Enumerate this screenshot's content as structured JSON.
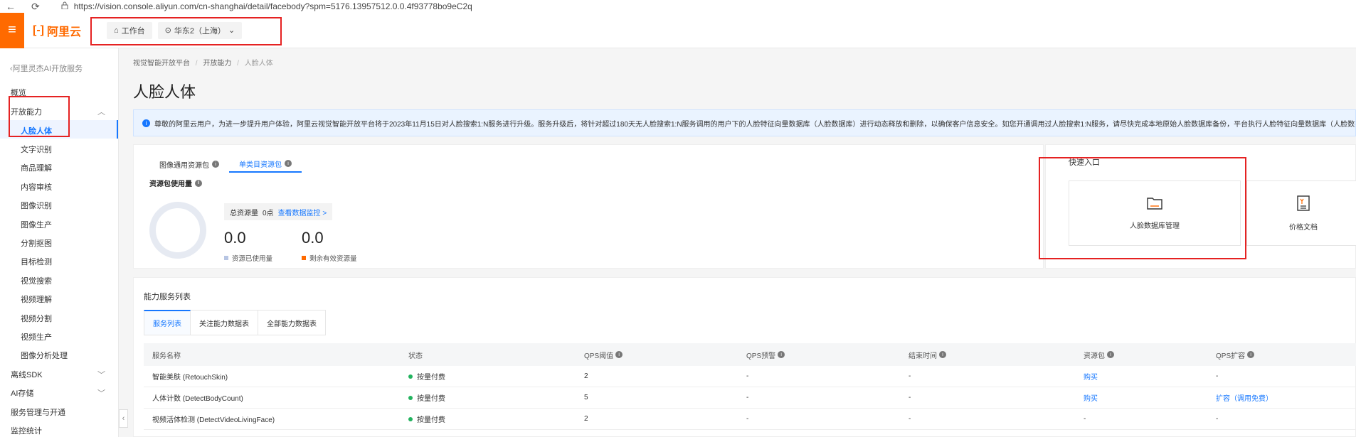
{
  "browser": {
    "back_icon": "←",
    "reload_icon": "⟳",
    "url": "https://vision.console.aliyun.com/cn-shanghai/detail/facebody?spm=5176.13957512.0.0.4f93778bo9eC2q"
  },
  "topbar": {
    "logo_text": "阿里云",
    "workbench": "工作台",
    "region": "华东2（上海）"
  },
  "sidebar": {
    "back_label": "阿里灵杰AI开放服务",
    "items": {
      "overview": "概览",
      "open_ability": "开放能力",
      "face_body": "人脸人体",
      "ocr": "文字识别",
      "goods": "商品理解",
      "content_audit": "内容审核",
      "image_recog": "图像识别",
      "image_gen": "图像生产",
      "segment": "分割抠图",
      "detect": "目标检测",
      "visual_search": "视觉搜索",
      "video_understand": "视频理解",
      "video_segment": "视频分割",
      "video_gen": "视频生产",
      "image_analysis": "图像分析处理",
      "offline_sdk": "离线SDK",
      "ai_storage": "AI存储",
      "service_mgmt": "服务管理与开通",
      "monitor": "监控统计"
    }
  },
  "main": {
    "breadcrumb": [
      "视觉智能开放平台",
      "开放能力",
      "人脸人体"
    ],
    "title": "人脸人体",
    "notice": "尊敬的阿里云用户，为进一步提升用户体验，阿里云视觉智能开放平台将于2023年11月15日对人脸搜索1:N服务进行升级。服务升级后，将针对超过180天无人脸搜索1:N服务调用的用户下的人脸特征向量数据库（人脸数据库）进行动态释放和删除，以确保客户信息安全。如您开通调用过人脸搜索1:N服务，请尽快完成本地原始人脸数据库备份，平台执行人脸特征向量数据库（人脸数据库）",
    "resource_tabs": [
      "图像通用资源包",
      "单类目资源包"
    ],
    "usage_label": "资源包使用量",
    "total_label": "总资源量",
    "total_value": "0点",
    "monitor_link": "查看数据监控 >",
    "used_value": "0.0",
    "used_label": "资源已使用量",
    "remain_value": "0.0",
    "remain_label": "剩余有效资源量",
    "used_color": "#b7c5e3",
    "remain_color": "#ff6a00",
    "quick_title": "快速入口",
    "quick_items": [
      "人脸数据库管理",
      "价格文档"
    ],
    "list_title": "能力服务列表",
    "list_tabs": [
      "服务列表",
      "关注能力数据表",
      "全部能力数据表"
    ],
    "table_headers": [
      "服务名称",
      "状态",
      "QPS阈值",
      "QPS预警",
      "结束时间",
      "资源包",
      "QPS扩容"
    ],
    "rows": [
      {
        "name": "智能美肤 (RetouchSkin)",
        "status": "按量付费",
        "qps": "2",
        "warn": "-",
        "end": "-",
        "pack": "购买",
        "expand": "-"
      },
      {
        "name": "人体计数 (DetectBodyCount)",
        "status": "按量付费",
        "qps": "5",
        "warn": "-",
        "end": "-",
        "pack": "购买",
        "expand": "扩容（调用免费）"
      },
      {
        "name": "视频活体检测 (DetectVideoLivingFace)",
        "status": "按量付费",
        "qps": "2",
        "warn": "-",
        "end": "-",
        "pack": "-",
        "expand": "-"
      }
    ]
  },
  "accent": "#1677ff",
  "brand": "#ff6a00",
  "annotation_color": "#e52222"
}
